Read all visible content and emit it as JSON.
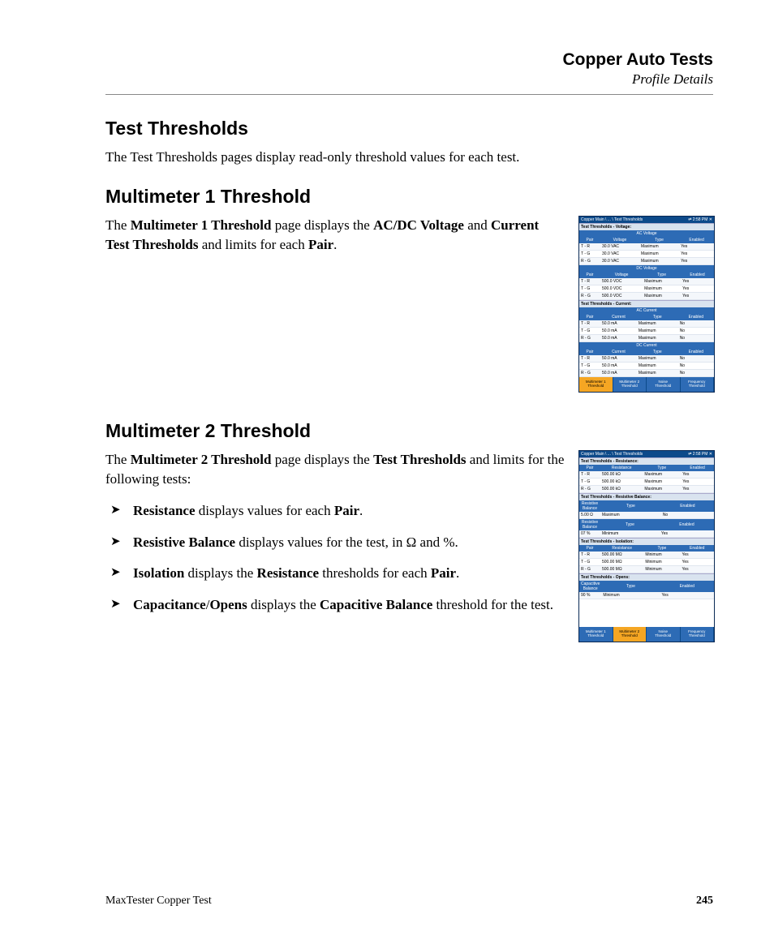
{
  "header": {
    "title": "Copper Auto Tests",
    "subtitle": "Profile Details"
  },
  "section1": {
    "heading": "Test Thresholds",
    "p": "The Test Thresholds pages display read-only threshold values for each test."
  },
  "section2": {
    "heading": "Multimeter 1 Threshold",
    "p_parts": [
      "The ",
      "Multimeter 1 Threshold",
      " page displays the ",
      "AC/DC Voltage",
      " and ",
      "Current Test Thresholds",
      " and limits for each ",
      "Pair",
      "."
    ]
  },
  "section3": {
    "heading": "Multimeter 2 Threshold",
    "p_parts": [
      "The ",
      "Multimeter 2 Threshold",
      " page displays the ",
      "Test Thresholds",
      " and limits for the following tests:"
    ],
    "bullets": [
      [
        "Resistance",
        " displays values for each ",
        "Pair",
        "."
      ],
      [
        "Resistive Balance",
        " displays values for the test, in Ω and %."
      ],
      [
        "Isolation",
        " displays the ",
        "Resistance",
        " thresholds for each ",
        "Pair",
        "."
      ],
      [
        "Capacitance",
        "/",
        "Opens",
        " displays the ",
        "Capacitive Balance",
        " threshold for the test."
      ]
    ]
  },
  "footer": {
    "product": "MaxTester Copper Test",
    "page": "245"
  },
  "fig1": {
    "breadcrumb": "Copper Main \\ ... \\ Test Thresholds",
    "time": "2:58 PM",
    "sections": [
      {
        "title": "Test Thresholds - Voltage:",
        "groups": [
          {
            "band": "AC Voltage",
            "cols": [
              "Pair",
              "Voltage",
              "Type",
              "Enabled"
            ],
            "rows": [
              [
                "T - R",
                "30.0 VAC",
                "Maximum",
                "Yes"
              ],
              [
                "T - G",
                "30.0 VAC",
                "Maximum",
                "Yes"
              ],
              [
                "R - G",
                "30.0 VAC",
                "Maximum",
                "Yes"
              ]
            ]
          },
          {
            "band": "DC Voltage",
            "cols": [
              "Pair",
              "Voltage",
              "Type",
              "Enabled"
            ],
            "rows": [
              [
                "T - R",
                "500.0 VDC",
                "Maximum",
                "Yes"
              ],
              [
                "T - G",
                "500.0 VDC",
                "Maximum",
                "Yes"
              ],
              [
                "R - G",
                "500.0 VDC",
                "Maximum",
                "Yes"
              ]
            ]
          }
        ]
      },
      {
        "title": "Test Thresholds - Current:",
        "groups": [
          {
            "band": "AC Current",
            "cols": [
              "Pair",
              "Current",
              "Type",
              "Enabled"
            ],
            "rows": [
              [
                "T - R",
                "50.0 mA",
                "Maximum",
                "No"
              ],
              [
                "T - G",
                "50.0 mA",
                "Maximum",
                "No"
              ],
              [
                "R - G",
                "50.0 mA",
                "Maximum",
                "No"
              ]
            ]
          },
          {
            "band": "DC Current",
            "cols": [
              "Pair",
              "Current",
              "Type",
              "Enabled"
            ],
            "rows": [
              [
                "T - R",
                "50.0 mA",
                "Maximum",
                "No"
              ],
              [
                "T - G",
                "50.0 mA",
                "Maximum",
                "No"
              ],
              [
                "R - G",
                "50.0 mA",
                "Maximum",
                "No"
              ]
            ]
          }
        ]
      }
    ],
    "tabs": [
      "Multimeter 1 Threshold",
      "Multimeter 2 Threshold",
      "Noise Threshold",
      "Frequency Threshold"
    ],
    "active_tab": 0
  },
  "fig2": {
    "breadcrumb": "Copper Main \\ ... \\ Test Thresholds",
    "time": "2:58 PM",
    "sections": [
      {
        "title": "Test Thresholds - Resistance:",
        "groups": [
          {
            "cols": [
              "Pair",
              "Resistance",
              "Type",
              "Enabled"
            ],
            "rows": [
              [
                "T - R",
                "500.00 kΩ",
                "Maximum",
                "Yes"
              ],
              [
                "T - G",
                "500.00 kΩ",
                "Maximum",
                "Yes"
              ],
              [
                "R - G",
                "500.00 kΩ",
                "Maximum",
                "Yes"
              ]
            ]
          }
        ]
      },
      {
        "title": "Test Thresholds - Resistive Balance:",
        "groups": [
          {
            "cols": [
              "Resistive Balance",
              "Type",
              "Enabled"
            ],
            "rows": [
              [
                "5.00 Ω",
                "Maximum",
                "No"
              ]
            ]
          },
          {
            "cols": [
              "Resistive Balance",
              "Type",
              "Enabled"
            ],
            "rows": [
              [
                "07 %",
                "Minimum",
                "Yes"
              ]
            ]
          }
        ]
      },
      {
        "title": "Test Thresholds - Isolation:",
        "groups": [
          {
            "cols": [
              "Pair",
              "Resistance",
              "Type",
              "Enabled"
            ],
            "rows": [
              [
                "T - R",
                "500.00 MΩ",
                "Minimum",
                "Yes"
              ],
              [
                "T - G",
                "500.00 MΩ",
                "Minimum",
                "Yes"
              ],
              [
                "R - G",
                "500.00 MΩ",
                "Minimum",
                "Yes"
              ]
            ]
          }
        ]
      },
      {
        "title": "Test Thresholds - Opens:",
        "groups": [
          {
            "cols": [
              "Capacitive Balance",
              "Type",
              "Enabled"
            ],
            "rows": [
              [
                "90 %",
                "Minimum",
                "Yes"
              ]
            ]
          }
        ]
      }
    ],
    "tabs": [
      "Multimeter 1 Threshold",
      "Multimeter 2 Threshold",
      "Noise Threshold",
      "Frequency Threshold"
    ],
    "active_tab": 1
  }
}
